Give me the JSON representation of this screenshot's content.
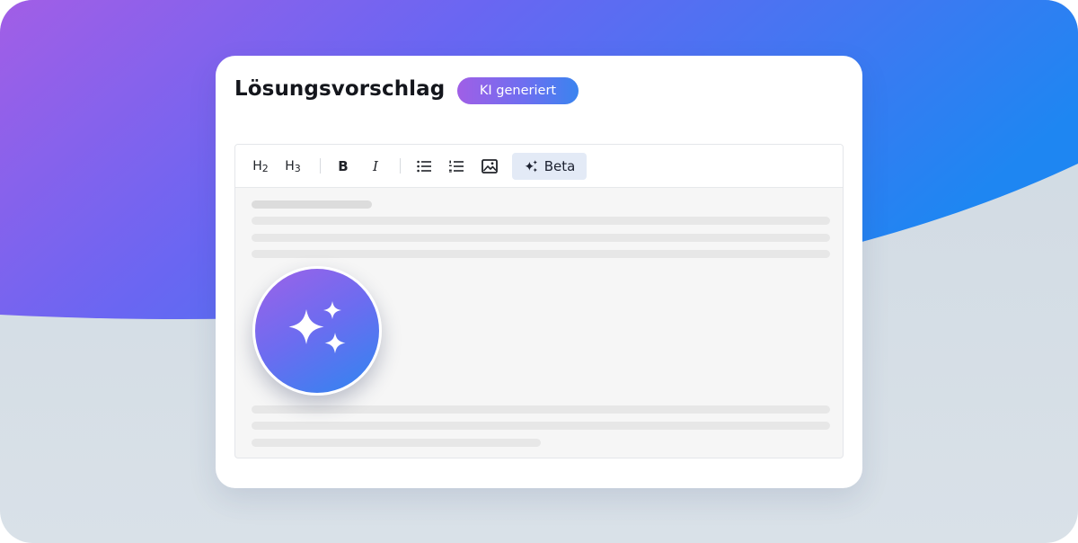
{
  "colors": {
    "gradient_purple": "#a05fe6",
    "gradient_blue": "#3a84ef",
    "beta_bg": "#e3eaf6"
  },
  "panel": {
    "title": "Lösungsvorschlag",
    "badge": "KI generiert"
  },
  "toolbar": {
    "heading2": {
      "main": "H",
      "sub": "2"
    },
    "heading3": {
      "main": "H",
      "sub": "3"
    },
    "bold": "B",
    "italic": "I",
    "bullet_list_icon": "bullet-list-icon",
    "numbered_list_icon": "numbered-list-icon",
    "image_icon": "image-icon",
    "ai_icon": "sparkle-icon",
    "beta_label": "Beta"
  },
  "ai_button_icon": "sparkles-icon"
}
